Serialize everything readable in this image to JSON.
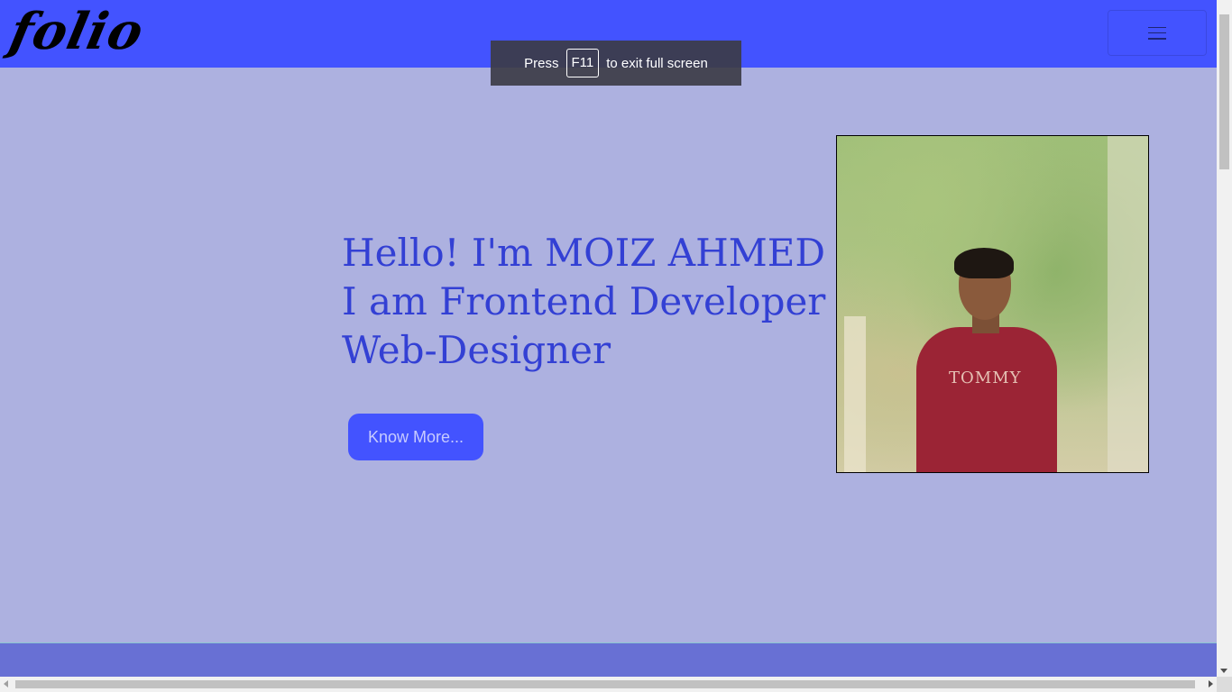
{
  "navbar": {
    "logo": "folio",
    "menu_icon": "hamburger-menu-icon",
    "background_color": "#4353ff"
  },
  "fullscreen_toast": {
    "prefix": "Press",
    "key": "F11",
    "suffix": "to exit full screen"
  },
  "hero": {
    "line1": "Hello! I'm MOIZ AHMED",
    "line2": "I am Frontend Developer &",
    "line3": "Web-Designer",
    "button_label": "Know More...",
    "text_color": "#3340d4"
  },
  "profile_photo": {
    "shirt_text": "TOMMY"
  },
  "colors": {
    "page_background": "#adb1e0",
    "footer_strip": "#6870d4"
  }
}
